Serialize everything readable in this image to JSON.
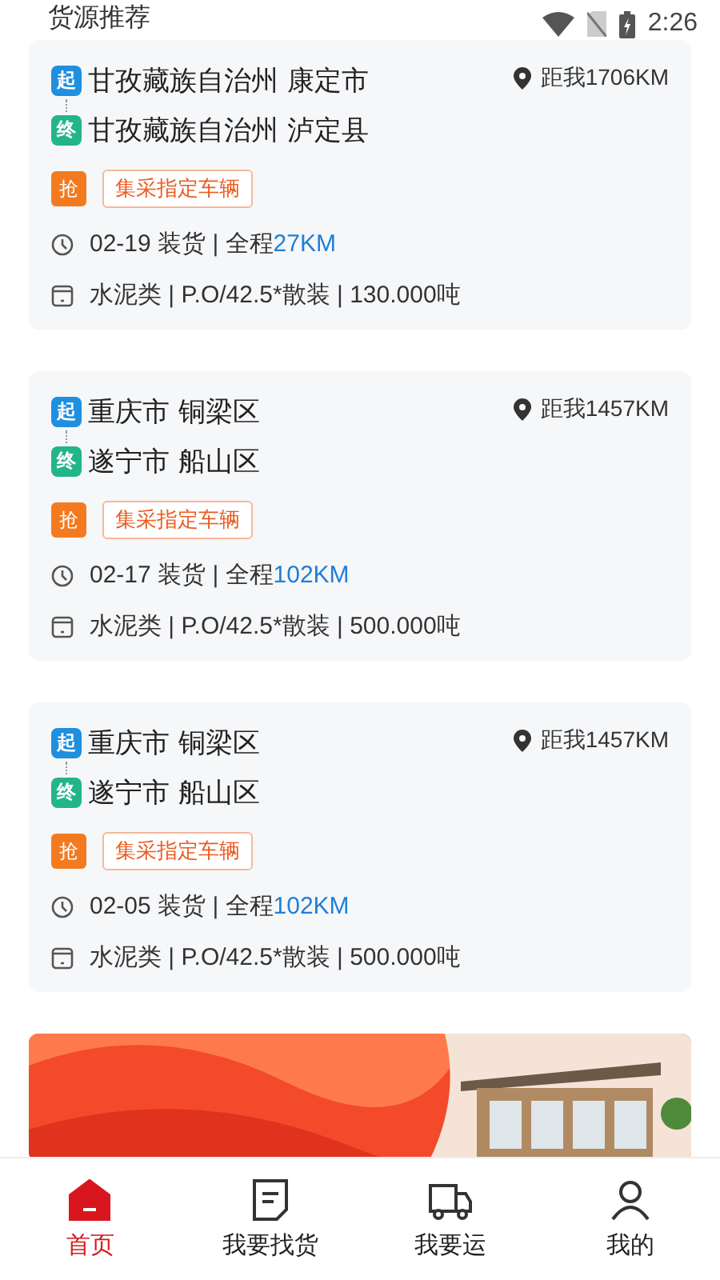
{
  "status_bar": {
    "time": "2:26"
  },
  "section_title": "货源推荐",
  "cards": [
    {
      "start_tag": "起",
      "start": "甘孜藏族自治州 康定市",
      "end_tag": "终",
      "end": "甘孜藏族自治州 泸定县",
      "distance": "距我1706KM",
      "grab_tag": "抢",
      "label": "集采指定车辆",
      "date_text": "02-19 装货 | 全程",
      "route_km": "27KM",
      "cargo": "水泥类 | P.O/42.5*散装 | 130.000吨"
    },
    {
      "start_tag": "起",
      "start": "重庆市 铜梁区",
      "end_tag": "终",
      "end": "遂宁市 船山区",
      "distance": "距我1457KM",
      "grab_tag": "抢",
      "label": "集采指定车辆",
      "date_text": "02-17 装货 | 全程",
      "route_km": "102KM",
      "cargo": "水泥类 | P.O/42.5*散装 | 500.000吨"
    },
    {
      "start_tag": "起",
      "start": "重庆市 铜梁区",
      "end_tag": "终",
      "end": "遂宁市 船山区",
      "distance": "距我1457KM",
      "grab_tag": "抢",
      "label": "集采指定车辆",
      "date_text": "02-05 装货 | 全程",
      "route_km": "102KM",
      "cargo": "水泥类 | P.O/42.5*散装 | 500.000吨"
    }
  ],
  "nav": [
    {
      "kind": "home",
      "label": "首页",
      "selected": true
    },
    {
      "kind": "goods",
      "label": "我要找货",
      "selected": false
    },
    {
      "kind": "truck",
      "label": "我要运",
      "selected": false
    },
    {
      "kind": "user",
      "label": "我的",
      "selected": false
    }
  ]
}
